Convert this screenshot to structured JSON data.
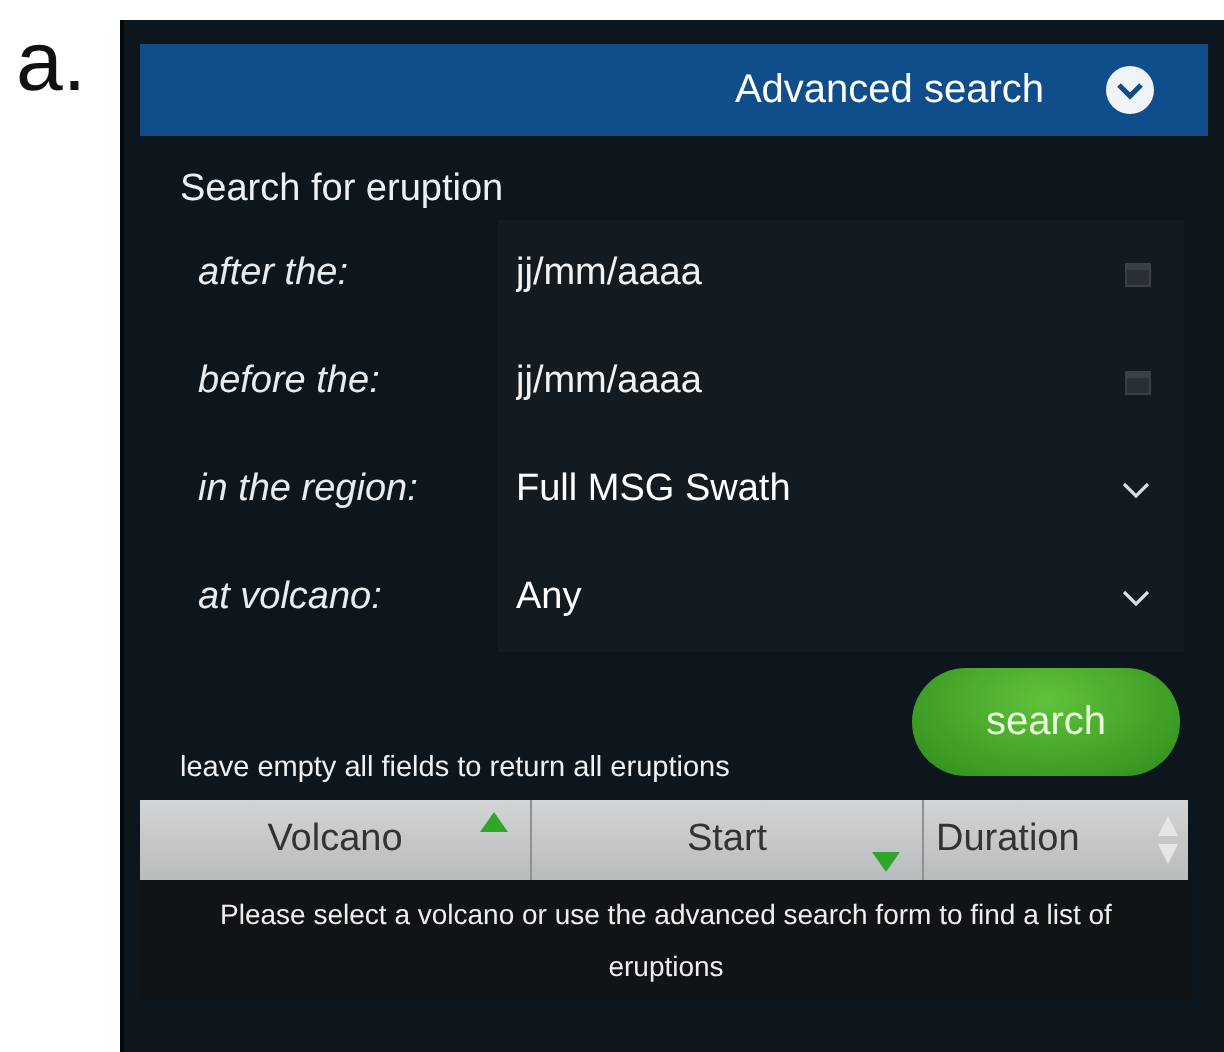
{
  "figure_label": "a.",
  "header": {
    "title": "Advanced search"
  },
  "form": {
    "title": "Search for eruption",
    "fields": [
      {
        "kind": "date",
        "label": "after the:",
        "placeholder": "jj/mm/aaaa"
      },
      {
        "kind": "date",
        "label": "before the:",
        "placeholder": "jj/mm/aaaa"
      },
      {
        "kind": "select",
        "label": "in the region:",
        "value": "Full MSG Swath"
      },
      {
        "kind": "select",
        "label": "at volcano:",
        "value": "Any"
      }
    ],
    "hint": "leave empty all fields to return all eruptions",
    "button": "search"
  },
  "table": {
    "columns": [
      {
        "label": "Volcano",
        "sorted": true,
        "ascending": true
      },
      {
        "label": "Start",
        "sorted": true,
        "ascending": false
      },
      {
        "label": "Duration",
        "sorted": false
      }
    ],
    "message": "Please select a volcano or use the advanced search form to find a list of eruptions"
  }
}
